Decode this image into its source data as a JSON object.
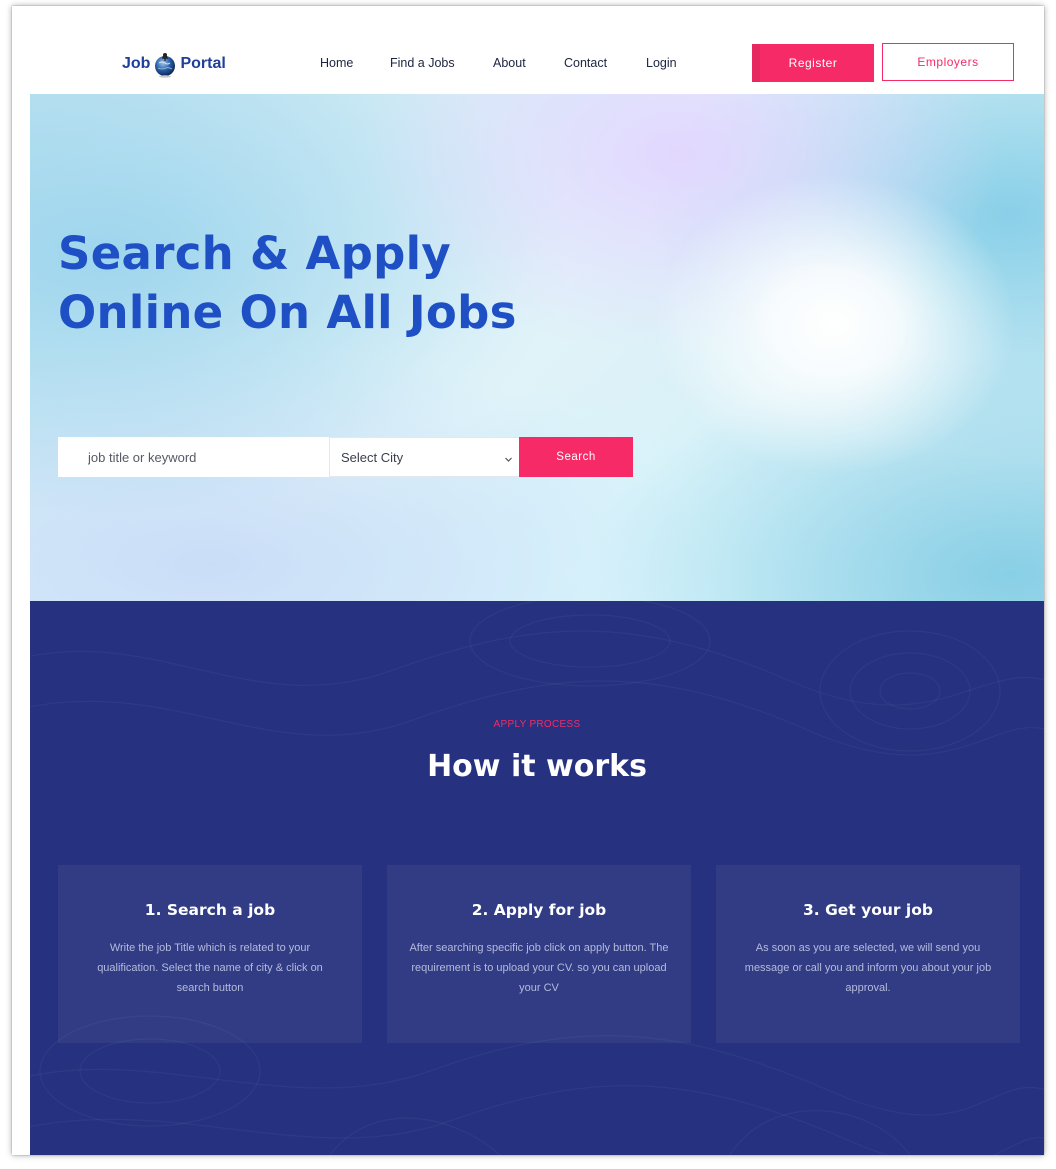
{
  "header": {
    "logo": {
      "left": "Job",
      "right": "Portal"
    },
    "nav": [
      {
        "label": "Home"
      },
      {
        "label": "Find a Jobs"
      },
      {
        "label": "About"
      },
      {
        "label": "Contact"
      },
      {
        "label": "Login"
      }
    ],
    "register_label": "Register",
    "employers_label": "Employers"
  },
  "hero": {
    "title": "Search & Apply Online On All Jobs",
    "search_placeholder": "job title or keyword",
    "city_select_value": "Select City",
    "search_button": "Search"
  },
  "process": {
    "eyebrow": "APPLY PROCESS",
    "title": "How it works",
    "steps": [
      {
        "title": "1. Search a job",
        "text": "Write the job Title which is related to your qualification. Select the name of city & click on search button"
      },
      {
        "title": "2. Apply for job",
        "text": "After searching specific job click on apply button. The requirement is to upload your CV. so you can upload your CV"
      },
      {
        "title": "3. Get your job",
        "text": "As soon as you are selected, we will send you message or call you and inform you about your job approval."
      }
    ]
  },
  "colors": {
    "accent": "#f62a66",
    "brand_blue": "#1f4fc4",
    "navy": "#26327f"
  },
  "icons": [
    "globe-logo-icon",
    "chevron-down-icon"
  ]
}
